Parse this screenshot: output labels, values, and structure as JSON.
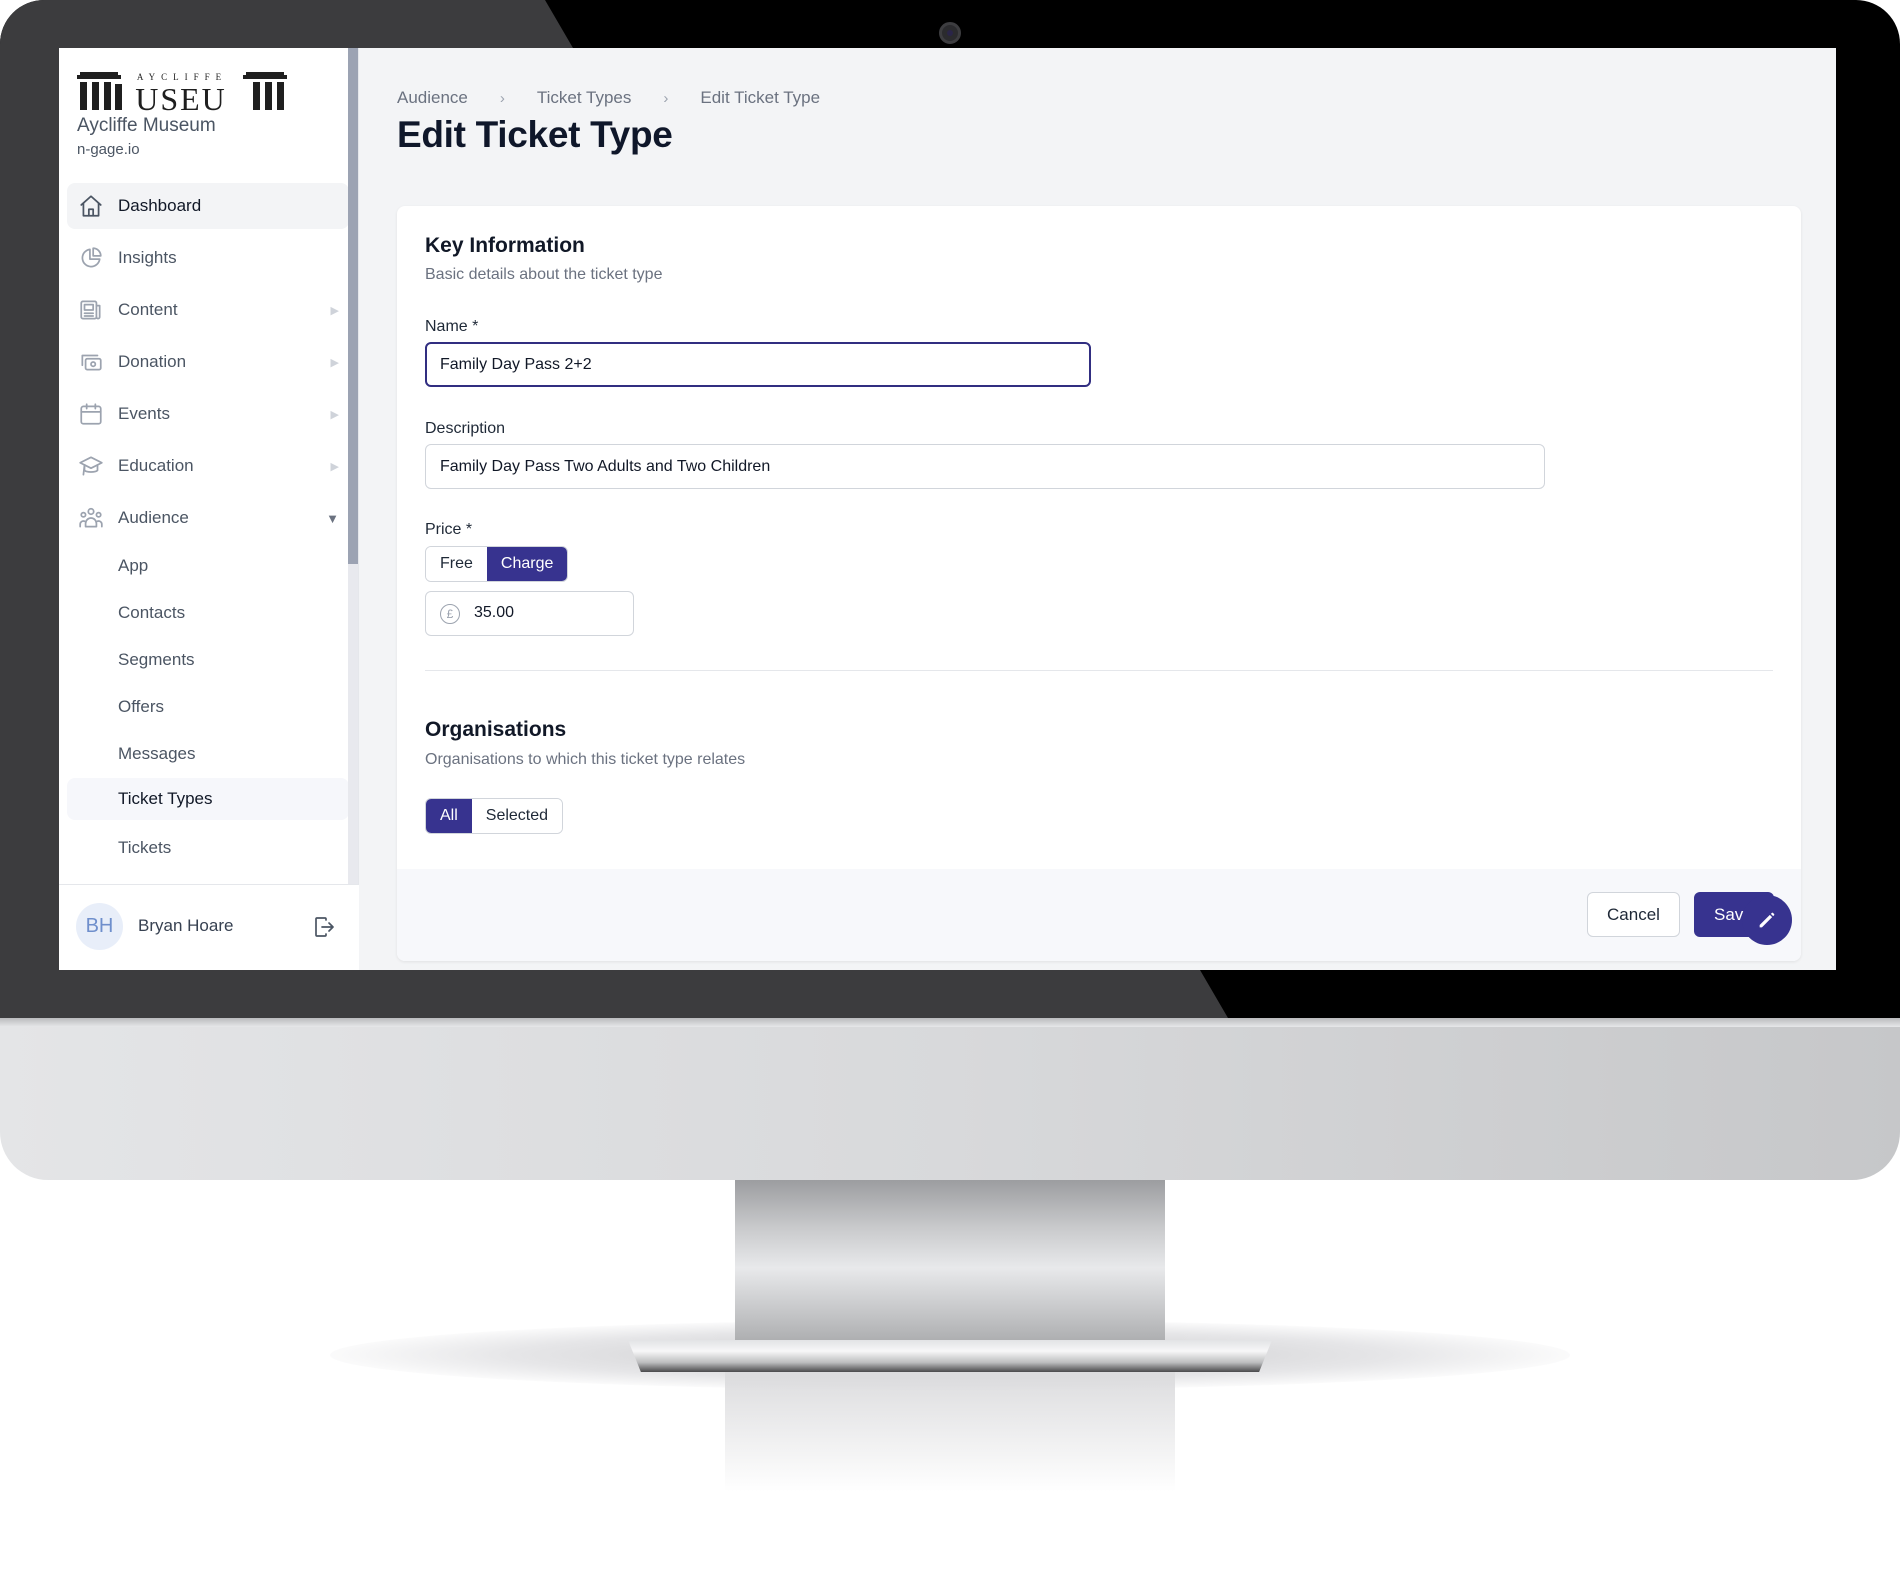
{
  "organisation": {
    "logo_top_text": "AYCLIFFE",
    "logo_main_text": "MUSEUM",
    "name": "Aycliffe Museum",
    "domain": "n-gage.io"
  },
  "sidebar": {
    "items": [
      {
        "label": "Dashboard",
        "icon": "home-icon",
        "active": true
      },
      {
        "label": "Insights",
        "icon": "pie-chart-icon"
      },
      {
        "label": "Content",
        "icon": "newspaper-icon",
        "expandable": true
      },
      {
        "label": "Donation",
        "icon": "cash-icon",
        "expandable": true
      },
      {
        "label": "Events",
        "icon": "calendar-icon",
        "expandable": true
      },
      {
        "label": "Education",
        "icon": "graduation-cap-icon",
        "expandable": true
      },
      {
        "label": "Audience",
        "icon": "users-icon",
        "expanded": true
      }
    ],
    "audience_subitems": [
      {
        "label": "App"
      },
      {
        "label": "Contacts"
      },
      {
        "label": "Segments"
      },
      {
        "label": "Offers"
      },
      {
        "label": "Messages"
      },
      {
        "label": "Ticket Types",
        "active": true
      },
      {
        "label": "Tickets"
      }
    ],
    "user": {
      "initials": "BH",
      "name": "Bryan Hoare"
    }
  },
  "header": {
    "breadcrumb": [
      "Audience",
      "Ticket Types",
      "Edit Ticket Type"
    ],
    "breadcrumb_separator": "›",
    "title": "Edit Ticket Type"
  },
  "form": {
    "key_info": {
      "title": "Key Information",
      "subtitle": "Basic details about the ticket type"
    },
    "name": {
      "label": "Name *",
      "value": "Family Day Pass 2+2"
    },
    "description": {
      "label": "Description",
      "value": "Family Day Pass Two Adults and Two Children"
    },
    "price": {
      "label": "Price *",
      "options": [
        "Free",
        "Charge"
      ],
      "selected": "Charge",
      "currency_symbol": "£",
      "value": "35.00"
    },
    "organisations": {
      "title": "Organisations",
      "subtitle": "Organisations to which this ticket type relates",
      "options": [
        "All",
        "Selected"
      ],
      "selected": "All"
    }
  },
  "actions": {
    "cancel_label": "Cancel",
    "save_label": "Save"
  },
  "colors": {
    "accent": "#37338f",
    "focus_border": "#312e81"
  }
}
